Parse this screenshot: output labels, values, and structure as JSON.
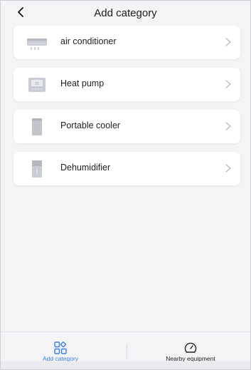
{
  "header": {
    "title": "Add category"
  },
  "categories": [
    {
      "label": "air conditioner",
      "icon": "air-conditioner-icon"
    },
    {
      "label": "Heat pump",
      "icon": "heat-pump-icon"
    },
    {
      "label": "Portable cooler",
      "icon": "portable-cooler-icon"
    },
    {
      "label": "Dehumidifier",
      "icon": "dehumidifier-icon"
    }
  ],
  "tabbar": {
    "tabs": [
      {
        "label": "Add category",
        "icon": "grid-icon",
        "active": true
      },
      {
        "label": "Nearby equipment",
        "icon": "gauge-icon",
        "active": false
      }
    ]
  },
  "colors": {
    "accent": "#3b7fe8",
    "background": "#f4f4f6",
    "card": "#ffffff",
    "text": "#222222",
    "chevron": "#b9b9be"
  }
}
